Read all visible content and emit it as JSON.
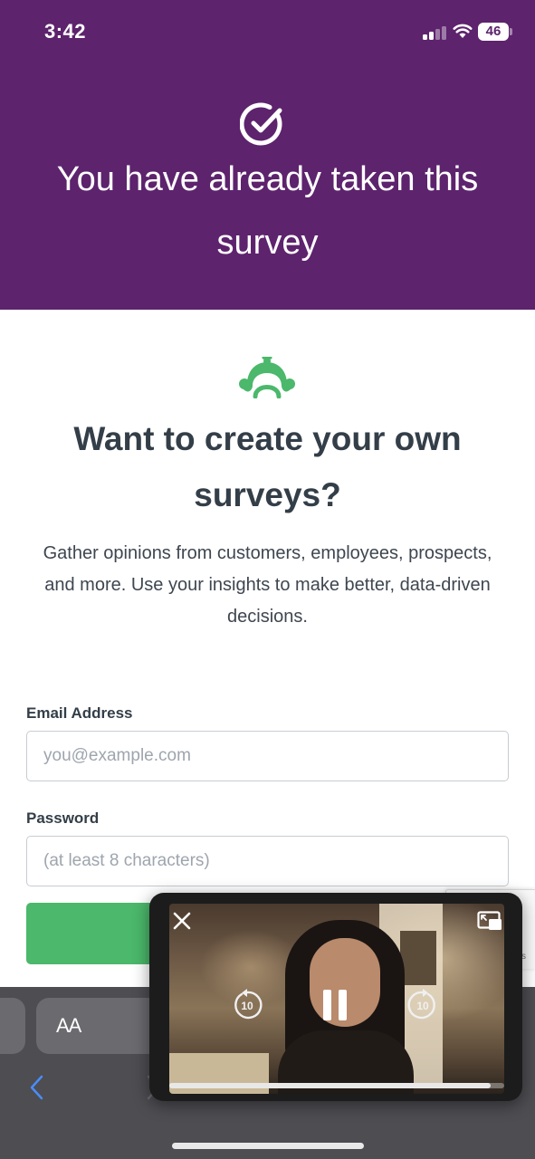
{
  "status_bar": {
    "time": "3:42",
    "battery": "46"
  },
  "hero": {
    "title": "You have already taken this survey"
  },
  "promo": {
    "title": "Want to create your own surveys?",
    "subtitle": "Gather opinions from customers, employees, prospects, and more. Use your insights to make better, data-driven decisions."
  },
  "form": {
    "email_label": "Email Address",
    "email_placeholder": "you@example.com",
    "email_value": "",
    "password_label": "Password",
    "password_placeholder": "(at least 8 characters)",
    "password_value": ""
  },
  "safari": {
    "aa_label": "AA"
  },
  "pip": {
    "progress": 0.96,
    "skip_back_seconds": "10",
    "skip_forward_seconds": "10"
  },
  "colors": {
    "header_purple": "#5d236d",
    "brand_green": "#4bb86b"
  },
  "icons": [
    "check-circle-icon",
    "monkey-logo-icon",
    "close-icon",
    "expand-pip-icon",
    "skip-back-icon",
    "pause-icon",
    "skip-forward-icon",
    "back-arrow-icon",
    "forward-arrow-icon"
  ]
}
